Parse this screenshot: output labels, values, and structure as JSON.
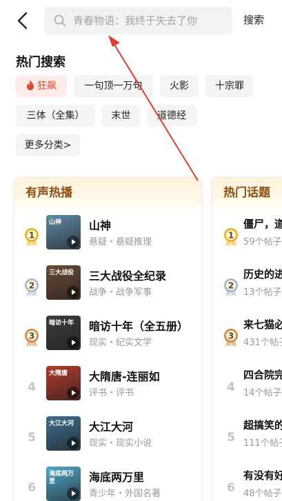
{
  "search": {
    "placeholder": "青春物语：我终于失去了你",
    "button_label": "搜索"
  },
  "hot_search": {
    "title": "热门搜索",
    "chips": [
      "狂飙",
      "一句顶一万句",
      "火影",
      "十宗罪",
      "三体（全集）",
      "末世",
      "道德经",
      "更多分类>"
    ]
  },
  "audio_hot": {
    "title": "有声热播",
    "items": [
      {
        "rank": "1",
        "title": "山神",
        "meta": "悬疑・悬疑推理",
        "cover_text": "山神",
        "cover_color": "#5f8aa5"
      },
      {
        "rank": "2",
        "title": "三大战役全纪录",
        "meta": "战争・战争军事",
        "cover_text": "三大战役",
        "cover_color": "#6b4a34"
      },
      {
        "rank": "3",
        "title": "暗访十年（全五册）",
        "meta": "现实・纪实文学",
        "cover_text": "暗访十年",
        "cover_color": "#3c3c3c"
      },
      {
        "rank": "4",
        "title": "大隋唐-连丽如",
        "meta": "评书・评书",
        "cover_text": "大隋唐",
        "cover_color": "#b23a2a"
      },
      {
        "rank": "5",
        "title": "大江大河",
        "meta": "现实・现实小说",
        "cover_text": "大江大河",
        "cover_color": "#3f6d8e"
      },
      {
        "rank": "6",
        "title": "海底两万里",
        "meta": "青少年・外国名著",
        "cover_text": "海底两万里",
        "cover_color": "#4fa6c9"
      }
    ]
  },
  "hot_topics": {
    "title": "热门话题",
    "items": [
      {
        "rank": "1",
        "title": "僵尸，道",
        "meta": "59个帖子"
      },
      {
        "rank": "2",
        "title": "历史的进",
        "meta": "13个帖子"
      },
      {
        "rank": "3",
        "title": "来七猫必",
        "meta": "431个帖子"
      },
      {
        "rank": "4",
        "title": "四合院完",
        "meta": "14个帖子"
      },
      {
        "rank": "5",
        "title": "超搞笑的",
        "meta": "111个帖子"
      },
      {
        "rank": "6",
        "title": "有没有好",
        "meta": "48个帖子"
      }
    ]
  },
  "colors": {
    "accent_red": "#e8462b",
    "gold": "#e9b21d",
    "silver": "#a9b8c6",
    "bronze": "#d58a4a"
  }
}
